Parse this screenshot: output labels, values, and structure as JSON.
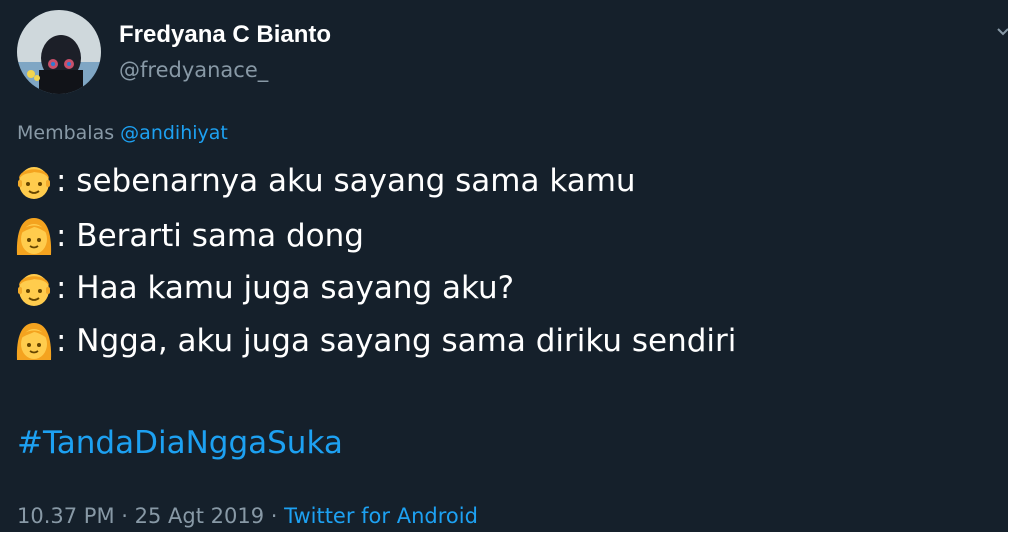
{
  "author": {
    "display_name": "Fredyana C Bianto",
    "handle": "@fredyanace_"
  },
  "reply": {
    "prefix": "Membalas",
    "mention": "@andihiyat"
  },
  "messages": [
    {
      "speaker_icon": "boy-emoji-icon",
      "text": ": sebenarnya aku sayang sama kamu"
    },
    {
      "speaker_icon": "girl-emoji-icon",
      "text": ": Berarti sama dong"
    },
    {
      "speaker_icon": "boy-emoji-icon",
      "text": ": Haa kamu juga sayang aku?"
    },
    {
      "speaker_icon": "girl-emoji-icon",
      "text": ": Ngga, aku juga sayang sama diriku sendiri"
    }
  ],
  "hashtag": "#TandaDiaNggaSuka",
  "meta": {
    "time": "10.37 PM",
    "separator_1": " · ",
    "date": "25 Agt 2019",
    "separator_2": " · ",
    "source": "Twitter for Android"
  },
  "colors": {
    "background": "#15202b",
    "primary_text": "#ffffff",
    "secondary_text": "#8899a6",
    "link": "#1da1f2"
  }
}
